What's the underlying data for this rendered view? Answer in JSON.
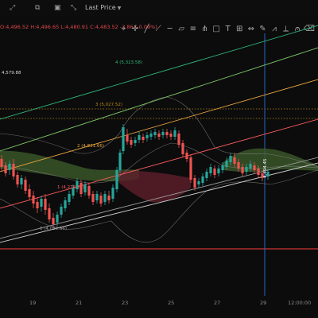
{
  "header": {
    "icons": [
      "fullscreen-icon",
      "screenshot-icon",
      "camera-icon",
      "expand-icon"
    ],
    "price_source": "Last Price"
  },
  "ohlc": "O:4,496.52 H:4,496.65 L:4,480.91 C:4,483.52 -3.86 (-0.09%)",
  "toolbar": {
    "tools": [
      {
        "name": "cursor-tool-icon",
        "glyph": "⌖"
      },
      {
        "name": "crosshair-tool-icon",
        "glyph": "✛"
      },
      {
        "name": "trendline-tool-icon",
        "glyph": "╱"
      },
      {
        "name": "ray-tool-icon",
        "glyph": "⟋"
      },
      {
        "name": "horizontal-line-tool-icon",
        "glyph": "─"
      },
      {
        "name": "channel-tool-icon",
        "glyph": "▱"
      },
      {
        "name": "fib-tool-icon",
        "glyph": "≡"
      },
      {
        "name": "pitchfork-tool-icon",
        "glyph": "⋔"
      },
      {
        "name": "rectangle-tool-icon",
        "glyph": "□"
      },
      {
        "name": "text-tool-icon",
        "glyph": "T"
      },
      {
        "name": "position-tool-icon",
        "glyph": "⊞"
      },
      {
        "name": "date-range-tool-icon",
        "glyph": "⇔"
      },
      {
        "name": "brush-tool-icon",
        "glyph": "✎"
      },
      {
        "name": "zigzag-tool-icon",
        "glyph": "⩘"
      },
      {
        "name": "ruler-tool-icon",
        "glyph": "⟂"
      },
      {
        "name": "magnet-tool-icon",
        "glyph": "⩀"
      },
      {
        "name": "eraser-tool-icon",
        "glyph": "⌫"
      }
    ]
  },
  "chart_data": {
    "type": "candlestick",
    "price_labels": {
      "level_top_left": "4,579.88",
      "fib_4": "4 (5,323.58)",
      "fib_3": "3 (5,027.52)",
      "fib_2": "2 (4,831.66)",
      "fib_1": "1 (4,278.20)",
      "fib_0": "0 (4,088.36)"
    },
    "x_ticks": [
      "19",
      "21",
      "23",
      "25",
      "27",
      "29",
      "12:00:00"
    ],
    "crosshair_label": "4,494.45",
    "colors": {
      "up": "#26a69a",
      "down": "#ef5350",
      "cloud_bull": "#3c5a2a",
      "cloud_bear": "#5a1e2a",
      "fib_line": "#e67e22",
      "trend_green": "#2ecc71",
      "trend_red": "#ff5c5c",
      "support_line": "#ff3b3b",
      "crosshair": "#2d6ed8"
    }
  }
}
